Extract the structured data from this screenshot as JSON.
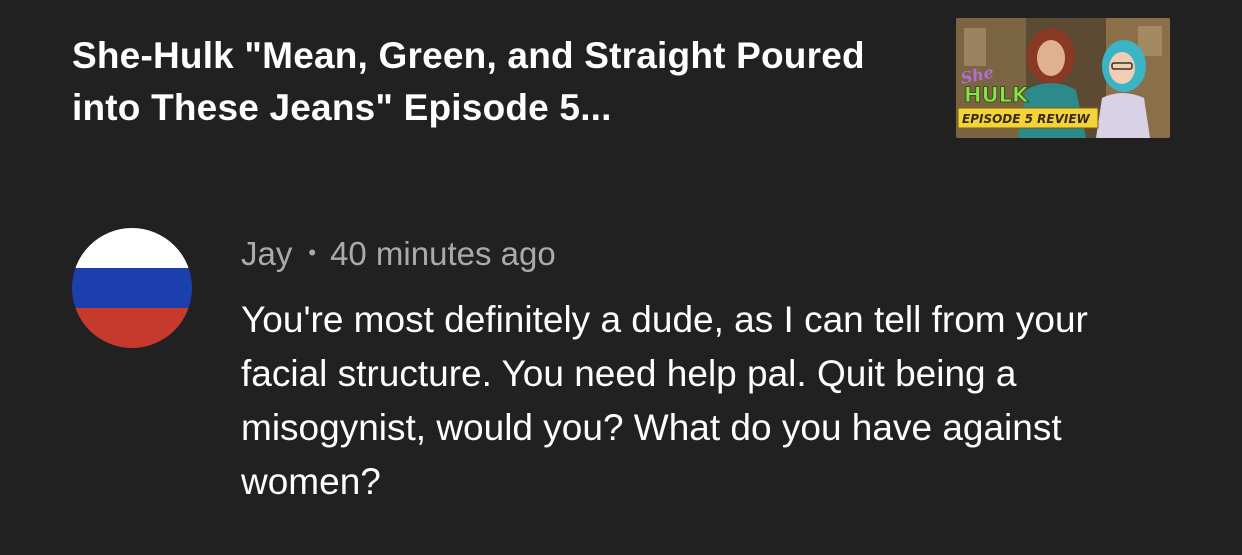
{
  "video": {
    "title": "She-Hulk \"Mean, Green, and Straight Poured into These Jeans\" Episode 5...",
    "thumbnail": {
      "logo_script": "She",
      "logo_main": "HULK",
      "banner": "EPISODE 5 REVIEW",
      "colors": {
        "background": "#6b5a3c",
        "logo_green": "#8fe04a",
        "logo_purple": "#b06fd8",
        "banner_yellow": "#f2d33a"
      }
    }
  },
  "comment": {
    "author": "Jay",
    "separator": "•",
    "timestamp": "40 minutes ago",
    "text": "You're most definitely a dude, as I can tell from your facial structure. You need help pal. Quit being a misogynist, would you? What do you have against women?",
    "avatar": {
      "type": "flag",
      "colors": [
        "#ffffff",
        "#1c3fae",
        "#c63a2e"
      ]
    }
  }
}
